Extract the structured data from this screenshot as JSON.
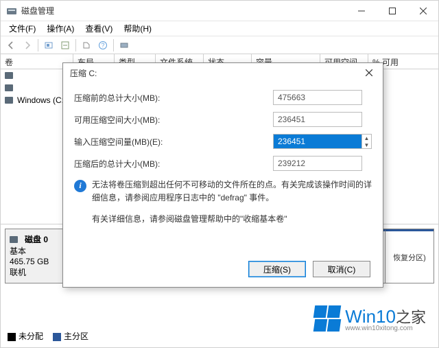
{
  "app": {
    "title": "磁盘管理"
  },
  "menu": {
    "file": "文件(F)",
    "action": "操作(A)",
    "view": "查看(V)",
    "help": "帮助(H)"
  },
  "columns": {
    "volume": "卷",
    "layout": "布局",
    "type": "类型",
    "filesystem": "文件系统",
    "status": "状态",
    "capacity": "容量",
    "free": "可用空间",
    "percent": "% 可用"
  },
  "rows": [
    {
      "label": ""
    },
    {
      "label": ""
    },
    {
      "label": "Windows (C:)"
    }
  ],
  "disk": {
    "name": "磁盘 0",
    "type": "基本",
    "size": "465.75 GB",
    "status": "联机",
    "recovery_label": "恢复分区)"
  },
  "legend": {
    "unallocated": "未分配",
    "primary": "主分区"
  },
  "dialog": {
    "title": "压缩 C:",
    "before_label": "压缩前的总计大小(MB):",
    "before_value": "475663",
    "avail_label": "可用压缩空间大小(MB):",
    "avail_value": "236451",
    "shrink_label": "输入压缩空间量(MB)(E):",
    "shrink_value": "236451",
    "after_label": "压缩后的总计大小(MB):",
    "after_value": "239212",
    "info_text": "无法将卷压缩到超出任何不可移动的文件所在的点。有关完成该操作时间的详细信息，请参阅应用程序日志中的 \"defrag\" 事件。",
    "help_text": "有关详细信息，请参阅磁盘管理帮助中的\"收缩基本卷\"",
    "shrink_btn": "压缩(S)",
    "cancel_btn": "取消(C)"
  },
  "watermark": {
    "brand": "Win10",
    "suffix": "之家",
    "url": "www.win10xitong.com"
  }
}
